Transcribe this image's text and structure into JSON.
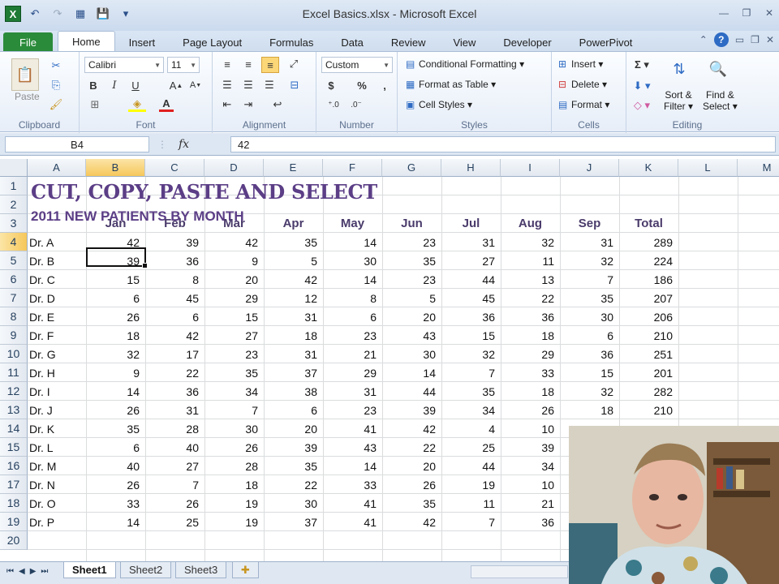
{
  "window": {
    "title": "Excel Basics.xlsx - Microsoft Excel",
    "app_icon": "X",
    "controls": [
      "—",
      "❐",
      "✕"
    ]
  },
  "ribbon_tabs": [
    "File",
    "Home",
    "Insert",
    "Page Layout",
    "Formulas",
    "Data",
    "Review",
    "View",
    "Developer",
    "PowerPivot"
  ],
  "ribbon": {
    "clipboard": {
      "paste": "Paste",
      "label": "Clipboard"
    },
    "font": {
      "name": "Calibri",
      "size": "11",
      "label": "Font"
    },
    "alignment": {
      "label": "Alignment"
    },
    "number": {
      "format": "Custom",
      "currency": "$",
      "percent": "%",
      "comma": ",",
      "label": "Number"
    },
    "styles": {
      "conditional": "Conditional Formatting",
      "table": "Format as Table",
      "cell_styles": "Cell Styles",
      "label": "Styles"
    },
    "cells": {
      "insert": "Insert",
      "delete": "Delete",
      "format": "Format",
      "label": "Cells"
    },
    "editing": {
      "sort_line1": "Sort &",
      "sort_line2": "Filter",
      "find_line1": "Find &",
      "find_line2": "Select",
      "label": "Editing"
    }
  },
  "formula_bar": {
    "name_box": "B4",
    "fx": "fx",
    "value": "42"
  },
  "columns": [
    "A",
    "B",
    "C",
    "D",
    "E",
    "F",
    "G",
    "H",
    "I",
    "J",
    "K",
    "L",
    "M"
  ],
  "selected_column": "B",
  "rows": [
    "1",
    "2",
    "3",
    "4",
    "5",
    "6",
    "7",
    "8",
    "9",
    "10",
    "11",
    "12",
    "13",
    "14",
    "15",
    "16",
    "17",
    "18",
    "19",
    "20"
  ],
  "selected_row": "4",
  "sheet": {
    "title": "CUT, COPY, PASTE AND SELECT",
    "subtitle": "2011 NEW PATIENTS BY MONTH",
    "headers": [
      "Jan",
      "Feb",
      "Mar",
      "Apr",
      "May",
      "Jun",
      "Jul",
      "Aug",
      "Sep",
      "Total"
    ],
    "data": [
      {
        "name": "Dr. A",
        "values": [
          "42",
          "39",
          "42",
          "35",
          "14",
          "23",
          "31",
          "32",
          "31",
          "289"
        ]
      },
      {
        "name": "Dr. B",
        "values": [
          "39",
          "36",
          "9",
          "5",
          "30",
          "35",
          "27",
          "11",
          "32",
          "224"
        ]
      },
      {
        "name": "Dr. C",
        "values": [
          "15",
          "8",
          "20",
          "42",
          "14",
          "23",
          "44",
          "13",
          "7",
          "186"
        ]
      },
      {
        "name": "Dr. D",
        "values": [
          "6",
          "45",
          "29",
          "12",
          "8",
          "5",
          "45",
          "22",
          "35",
          "207"
        ]
      },
      {
        "name": "Dr. E",
        "values": [
          "26",
          "6",
          "15",
          "31",
          "6",
          "20",
          "36",
          "36",
          "30",
          "206"
        ]
      },
      {
        "name": "Dr. F",
        "values": [
          "18",
          "42",
          "27",
          "18",
          "23",
          "43",
          "15",
          "18",
          "6",
          "210"
        ]
      },
      {
        "name": "Dr. G",
        "values": [
          "32",
          "17",
          "23",
          "31",
          "21",
          "30",
          "32",
          "29",
          "36",
          "251"
        ]
      },
      {
        "name": "Dr. H",
        "values": [
          "9",
          "22",
          "35",
          "37",
          "29",
          "14",
          "7",
          "33",
          "15",
          "201"
        ]
      },
      {
        "name": "Dr. I",
        "values": [
          "14",
          "36",
          "34",
          "38",
          "31",
          "44",
          "35",
          "18",
          "32",
          "282"
        ]
      },
      {
        "name": "Dr. J",
        "values": [
          "26",
          "31",
          "7",
          "6",
          "23",
          "39",
          "34",
          "26",
          "18",
          "210"
        ]
      },
      {
        "name": "Dr. K",
        "values": [
          "35",
          "28",
          "30",
          "20",
          "41",
          "42",
          "4",
          "10",
          "",
          ""
        ]
      },
      {
        "name": "Dr. L",
        "values": [
          "6",
          "40",
          "26",
          "39",
          "43",
          "22",
          "25",
          "39",
          "",
          ""
        ]
      },
      {
        "name": "Dr. M",
        "values": [
          "40",
          "27",
          "28",
          "35",
          "14",
          "20",
          "44",
          "34",
          "",
          ""
        ]
      },
      {
        "name": "Dr. N",
        "values": [
          "26",
          "7",
          "18",
          "22",
          "33",
          "26",
          "19",
          "10",
          "",
          ""
        ]
      },
      {
        "name": "Dr. O",
        "values": [
          "33",
          "26",
          "19",
          "30",
          "41",
          "35",
          "11",
          "21",
          "",
          ""
        ]
      },
      {
        "name": "Dr. P",
        "values": [
          "14",
          "25",
          "19",
          "37",
          "41",
          "42",
          "7",
          "36",
          "",
          ""
        ]
      }
    ]
  },
  "sheet_tabs": [
    "Sheet1",
    "Sheet2",
    "Sheet3"
  ],
  "active_sheet": "Sheet1",
  "colors": {
    "title": "#5b3e86",
    "file_tab": "#2a8b3a",
    "selection_header": "#f6c75b"
  }
}
